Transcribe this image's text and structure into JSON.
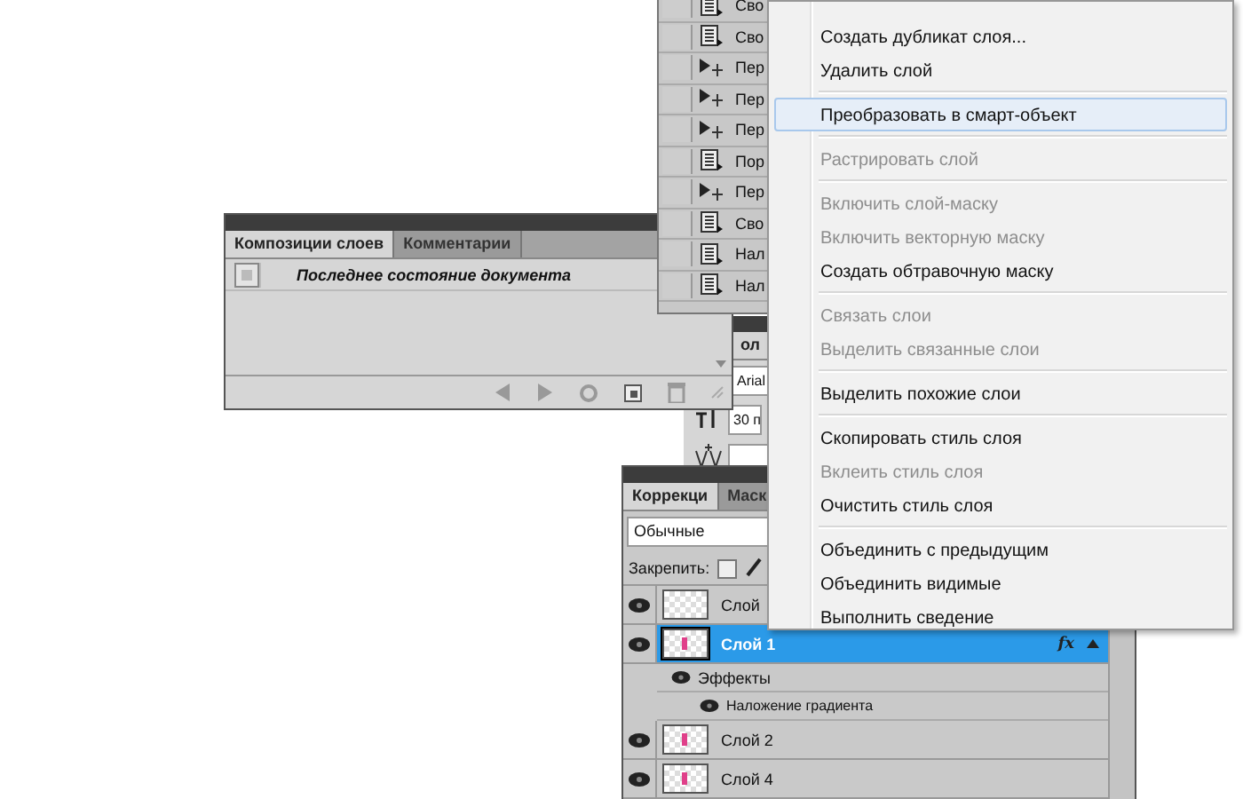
{
  "layer_comps_panel": {
    "tabs": [
      {
        "label": "Композиции слоев",
        "selected": true
      },
      {
        "label": "Комментарии",
        "selected": false
      }
    ],
    "comps": [
      {
        "label": "Последнее состояние документа"
      }
    ]
  },
  "actions_panel": {
    "rows": [
      {
        "kind": "command",
        "label": "Сво",
        "checked": false
      },
      {
        "kind": "command",
        "label": "Сво",
        "checked": false
      },
      {
        "kind": "step",
        "label": "Пер",
        "checked": false
      },
      {
        "kind": "step",
        "label": "Пер",
        "checked": false
      },
      {
        "kind": "step",
        "label": "Пер",
        "checked": false
      },
      {
        "kind": "command",
        "label": "Пор",
        "checked": false
      },
      {
        "kind": "step",
        "label": "Пер",
        "checked": false
      },
      {
        "kind": "command",
        "label": "Сво",
        "checked": false
      },
      {
        "kind": "command",
        "label": "Нал",
        "checked": false
      },
      {
        "kind": "command",
        "label": "Нал",
        "checked": false
      }
    ]
  },
  "character_panel": {
    "tab": "ол",
    "font_field": "Arial",
    "size_field": "30 п"
  },
  "layers_panel": {
    "tabs": [
      {
        "label": "Коррекци",
        "selected": true
      },
      {
        "label": "Маск",
        "selected": false
      }
    ],
    "blend_mode": "Обычные",
    "lock_label": "Закрепить:",
    "layers": [
      {
        "name": "Слой",
        "selected": false,
        "visible": true,
        "has_content": false
      },
      {
        "name": "Слой 1",
        "selected": true,
        "visible": true,
        "fx_badge": "fx",
        "has_content": true,
        "children": [
          {
            "name": "Эффекты",
            "visible": true,
            "children": [
              {
                "name": "Наложение градиента",
                "visible": true
              }
            ]
          }
        ]
      },
      {
        "name": "Слой 2",
        "selected": false,
        "visible": true,
        "has_content": true
      },
      {
        "name": "Слой 4",
        "selected": false,
        "visible": true,
        "has_content": true
      }
    ]
  },
  "context_menu": {
    "items": [
      {
        "kind": "item",
        "label": "Создать дубликат слоя...",
        "disabled": false,
        "selected": false
      },
      {
        "kind": "item",
        "label": "Удалить слой",
        "disabled": false,
        "selected": false
      },
      {
        "kind": "separator"
      },
      {
        "kind": "item",
        "label": "Преобразовать в смарт-объект",
        "disabled": false,
        "selected": true
      },
      {
        "kind": "separator"
      },
      {
        "kind": "item",
        "label": "Растрировать слой",
        "disabled": true,
        "selected": false
      },
      {
        "kind": "separator"
      },
      {
        "kind": "item",
        "label": "Включить слой-маску",
        "disabled": true,
        "selected": false
      },
      {
        "kind": "item",
        "label": "Включить векторную маску",
        "disabled": true,
        "selected": false
      },
      {
        "kind": "item",
        "label": "Создать обтравочную маску",
        "disabled": false,
        "selected": false
      },
      {
        "kind": "separator"
      },
      {
        "kind": "item",
        "label": "Связать слои",
        "disabled": true,
        "selected": false
      },
      {
        "kind": "item",
        "label": "Выделить связанные слои",
        "disabled": true,
        "selected": false
      },
      {
        "kind": "separator"
      },
      {
        "kind": "item",
        "label": "Выделить похожие слои",
        "disabled": false,
        "selected": false
      },
      {
        "kind": "separator"
      },
      {
        "kind": "item",
        "label": "Скопировать стиль слоя",
        "disabled": false,
        "selected": false
      },
      {
        "kind": "item",
        "label": "Вклеить стиль слоя",
        "disabled": true,
        "selected": false
      },
      {
        "kind": "item",
        "label": "Очистить стиль слоя",
        "disabled": false,
        "selected": false
      },
      {
        "kind": "separator"
      },
      {
        "kind": "item",
        "label": "Объединить с предыдущим",
        "disabled": false,
        "selected": false
      },
      {
        "kind": "item",
        "label": "Объединить видимые",
        "disabled": false,
        "selected": false
      },
      {
        "kind": "item",
        "label": "Выполнить сведение",
        "disabled": false,
        "selected": false
      }
    ]
  }
}
